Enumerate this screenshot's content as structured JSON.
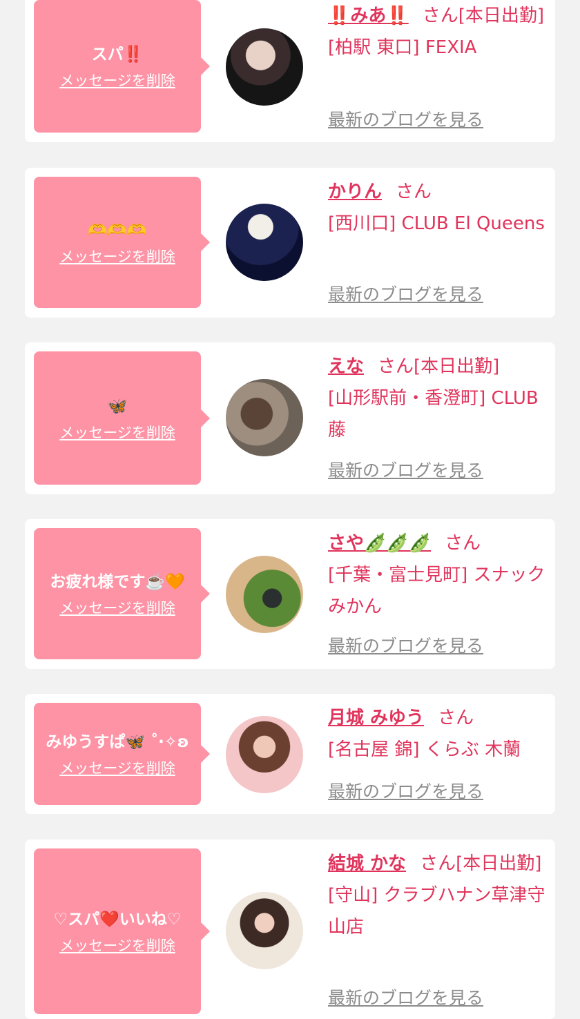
{
  "cards": [
    {
      "message": "スパ‼️",
      "name": "‼️みあ‼️",
      "san": "さん",
      "suffix": "[本日出勤]",
      "shop": "[柏駅 東口] FEXIA",
      "delete": "メッセージを削除",
      "blog": "最新のブログを見る"
    },
    {
      "message": "🫶🫶🫶",
      "name": "かりん",
      "san": "さん",
      "suffix": "",
      "shop": "[西川口] CLUB El Queens",
      "delete": "メッセージを削除",
      "blog": "最新のブログを見る"
    },
    {
      "message": "🦋",
      "name": "えな",
      "san": "さん",
      "suffix": "[本日出勤]",
      "shop": "[山形駅前・香澄町] CLUB 藤",
      "delete": "メッセージを削除",
      "blog": "最新のブログを見る"
    },
    {
      "message": "お疲れ様です☕️🧡",
      "name": "さや🫛🫛🫛",
      "san": "さん",
      "suffix": "",
      "shop": "[千葉・富士見町] スナックみかん",
      "delete": "メッセージを削除",
      "blog": "最新のブログを見る"
    },
    {
      "message": "みゆうすぱ🦋 ˚‧✧ʚ",
      "name": "月城 みゆう",
      "san": "さん",
      "suffix": "",
      "shop": "[名古屋 錦] くらぶ 木蘭",
      "delete": "メッセージを削除",
      "blog": "最新のブログを見る"
    },
    {
      "message": "♡スパ❤️いいね♡",
      "name": "結城 かな",
      "san": "さん",
      "suffix": "[本日出勤]",
      "shop": "[守山] クラブハナン草津守山店",
      "delete": "メッセージを削除",
      "blog": "最新のブログを見る"
    }
  ],
  "colors": {
    "background": "#f2f2f2",
    "card": "#ffffff",
    "bubble": "#fd93a5",
    "accent_text": "#e0345c",
    "link_gray": "#8c8c8c"
  }
}
